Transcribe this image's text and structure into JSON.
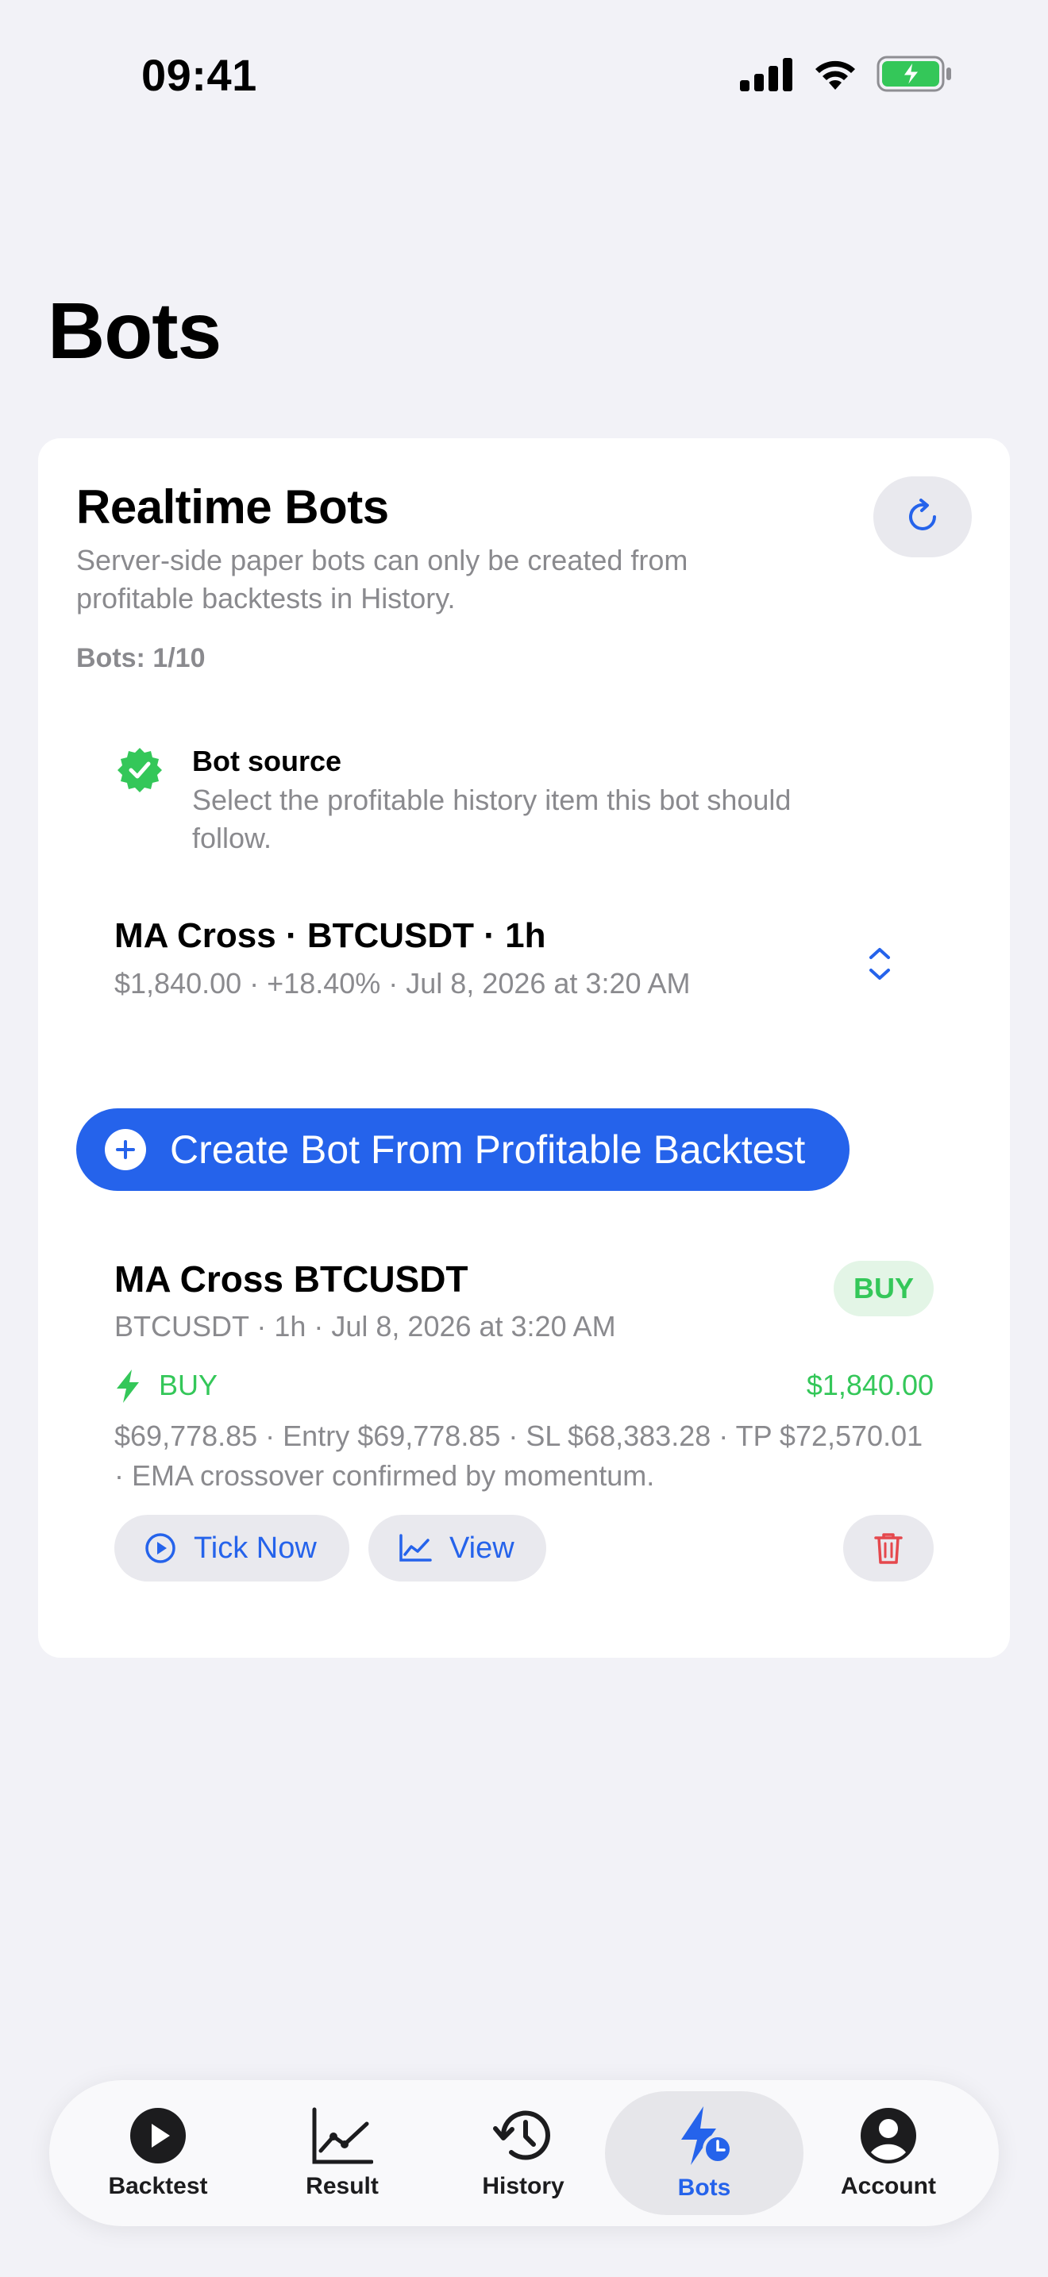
{
  "status_bar": {
    "time": "09:41"
  },
  "page": {
    "title": "Bots"
  },
  "card": {
    "title": "Realtime Bots",
    "description": "Server-side paper bots can only be created from profitable backtests in History.",
    "bots_count": "Bots: 1/10",
    "source": {
      "title": "Bot source",
      "description": "Select the profitable history item this bot should follow."
    },
    "picker": {
      "title": "MA Cross · BTCUSDT · 1h",
      "subtitle": "$1,840.00 · +18.40% · Jul 8, 2026 at 3:20 AM"
    },
    "create_button": "Create Bot From Profitable Backtest",
    "bot": {
      "name": "MA Cross BTCUSDT",
      "meta": "BTCUSDT · 1h · Jul 8, 2026 at 3:20 AM",
      "badge": "BUY",
      "signal": "BUY",
      "signal_value": "$1,840.00",
      "detail": "$69,778.85 · Entry $69,778.85 · SL $68,383.28 · TP $72,570.01 · EMA crossover confirmed by momentum.",
      "tick_button": "Tick Now",
      "view_button": "View"
    }
  },
  "tabs": [
    {
      "label": "Backtest",
      "icon": "play-circle-icon"
    },
    {
      "label": "Result",
      "icon": "chart-line-icon"
    },
    {
      "label": "History",
      "icon": "history-icon"
    },
    {
      "label": "Bots",
      "icon": "bolt-clock-icon",
      "active": true
    },
    {
      "label": "Account",
      "icon": "person-circle-icon"
    }
  ],
  "colors": {
    "accent": "#2563eb",
    "success": "#34c759",
    "danger": "#e5484d",
    "background": "#f2f2f7"
  }
}
